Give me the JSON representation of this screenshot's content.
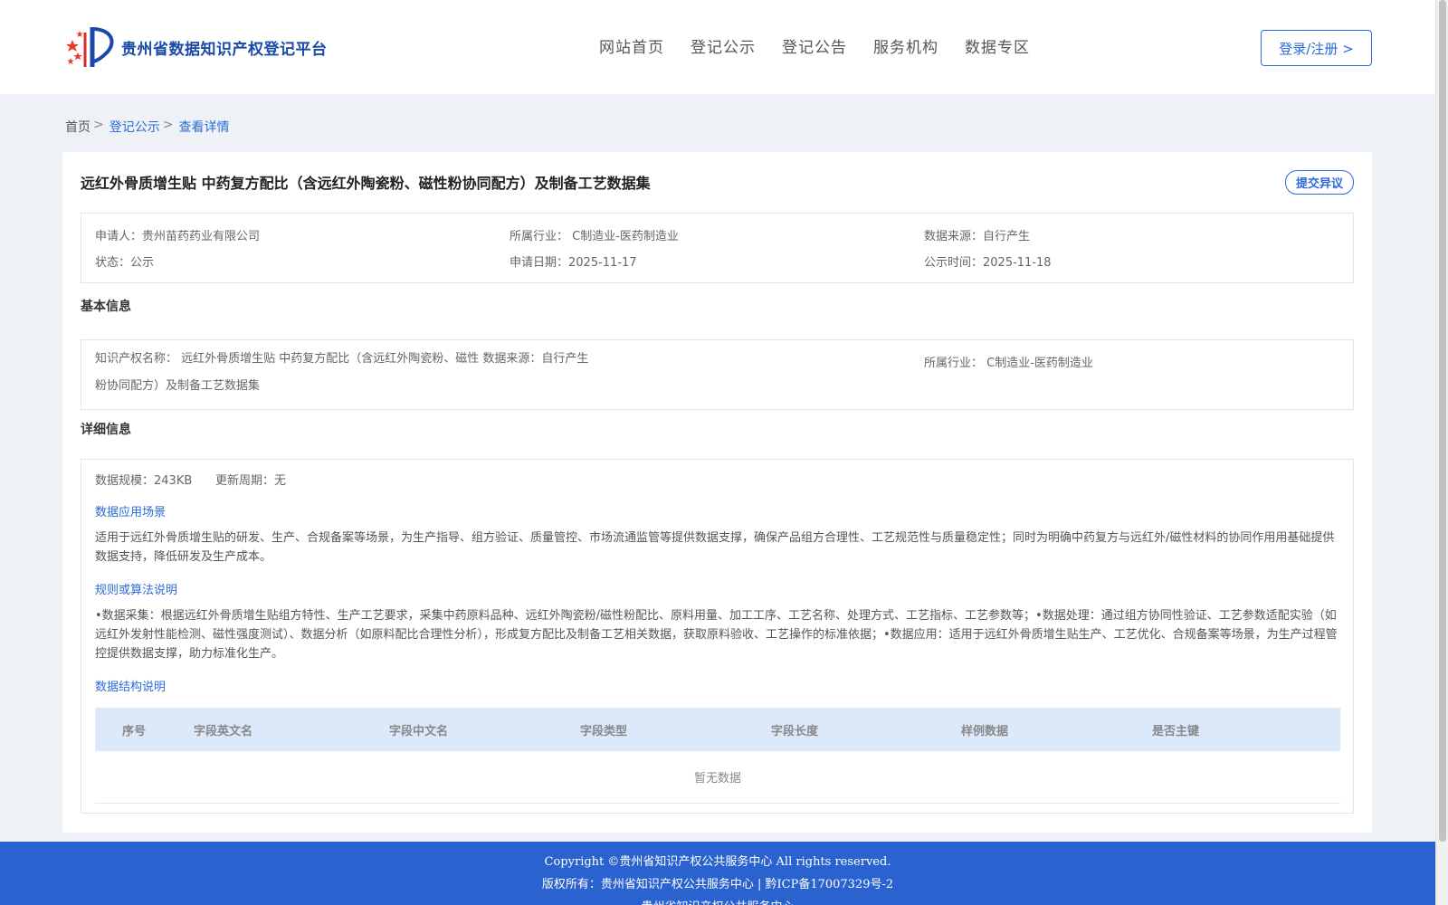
{
  "header": {
    "brand_name": "贵州省数据知识产权登记平台",
    "nav": [
      "网站首页",
      "登记公示",
      "登记公告",
      "服务机构",
      "数据专区"
    ],
    "login_label": "登录/注册 >"
  },
  "breadcrumb": {
    "home": "首页",
    "sep": ">",
    "level1": "登记公示",
    "level2": "查看详情"
  },
  "detail": {
    "title": "远红外骨质增生贴 中药复方配比（含远红外陶瓷粉、磁性粉协同配方）及制备工艺数据集",
    "objection_label": "提交异议",
    "meta": {
      "applicant": "申请人：贵州苗药药业有限公司",
      "industry": "所属行业：  C制造业-医药制造业",
      "source": "数据来源：自行产生",
      "status": "状态：公示",
      "apply_date": "申请日期：2025-11-17",
      "publish_time": "公示时间：2025-11-18"
    }
  },
  "basic": {
    "heading": "基本信息",
    "ip_name_line1": "知识产权名称：  远红外骨质增生贴 中药复方配比（含远红外陶瓷粉、磁性 数据来源：自行产生",
    "ip_name_line2": "粉协同配方）及制备工艺数据集",
    "industry": "所属行业：  C制造业-医药制造业"
  },
  "details": {
    "heading": "详细信息",
    "scale": "数据规模：243KB",
    "update_cycle": "更新周期：无",
    "scenario_heading": "数据应用场景",
    "scenario_text": "适用于远红外骨质增生贴的研发、生产、合规备案等场景，为生产指导、组方验证、质量管控、市场流通监管等提供数据支撑，确保产品组方合理性、工艺规范性与质量稳定性；同时为明确中药复方与远红外/磁性材料的协同作用用基础提供数据支持，降低研发及生产成本。",
    "rule_heading": "规则或算法说明",
    "rule_text": "•数据采集：根据远红外骨质增生贴组方特性、生产工艺要求，采集中药原料品种、远红外陶瓷粉/磁性粉配比、原料用量、加工工序、工艺名称、处理方式、工艺指标、工艺参数等；•数据处理：通过组方协同性验证、工艺参数适配实验（如远红外发射性能检测、磁性强度测试）、数据分析（如原料配比合理性分析），形成复方配比及制备工艺相关数据，获取原料验收、工艺操作的标准依据；•数据应用：适用于远红外骨质增生贴生产、工艺优化、合规备案等场景，为生产过程管控提供数据支撑，助力标准化生产。",
    "structure_heading": "数据结构说明",
    "table_headers": [
      "序号",
      "字段英文名",
      "字段中文名",
      "字段类型",
      "字段长度",
      "样例数据",
      "是否主键"
    ],
    "empty_text": "暂无数据"
  },
  "footer": {
    "copyright": "Copyright ©贵州省知识产权公共服务中心 All rights reserved.",
    "owner": "版权所有：贵州省知识产权公共服务中心 | 黔ICP备17007329号-2",
    "org": "贵州省知识产权公共服务中心"
  },
  "colors": {
    "accent": "#2b6bd8",
    "footer_bg": "#2a63cf",
    "table_head_bg": "#dce9fb",
    "page_bg": "#eef1f5"
  }
}
